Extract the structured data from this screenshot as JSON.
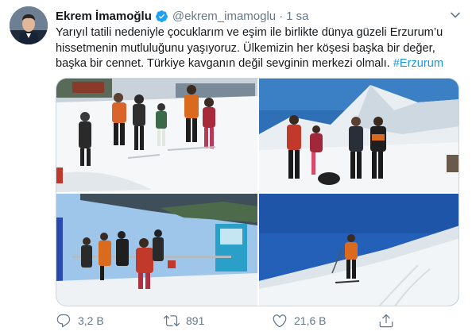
{
  "tweet": {
    "display_name": "Ekrem İmamoğlu",
    "handle": "@ekrem_imamoglu",
    "separator": "·",
    "time": "1 sa",
    "verified": true,
    "text_lines": [
      "Yarıyıl tatili nedeniyle çocuklarım ve eşim ile birlikte dünya güzeli Erzurum’u",
      "hissetmenin mutluluğunu yaşıyoruz. Ülkemizin her köşesi başka bir değer,",
      "başka bir cennet. Türkiye kavganın değil sevginin merkezi olmalı."
    ],
    "hashtag": "#Erzurum"
  },
  "actions": {
    "reply_count": "3,2 B",
    "retweet_count": "891",
    "like_count": "21,6 B"
  },
  "icons": {
    "verified": "verified-badge-icon",
    "caret": "chevron-down-icon",
    "reply": "reply-icon",
    "retweet": "retweet-icon",
    "like": "heart-icon",
    "share": "share-icon"
  },
  "colors": {
    "text": "#14171a",
    "secondary": "#657786",
    "link": "#1b95e0",
    "verified": "#1da1f2"
  }
}
